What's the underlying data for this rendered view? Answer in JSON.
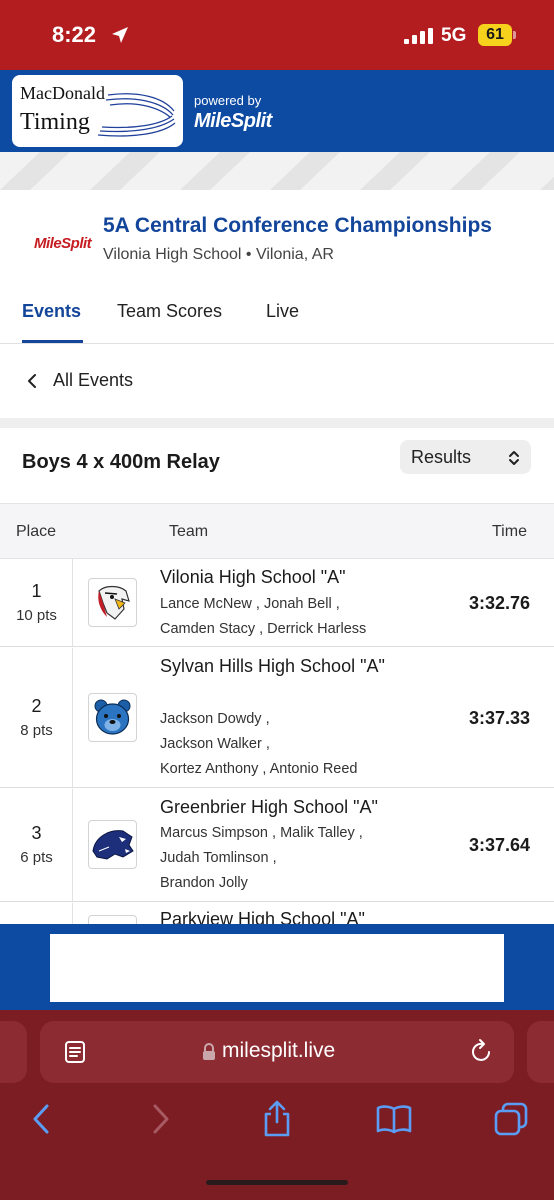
{
  "status_bar": {
    "time": "8:22",
    "network": "5G",
    "battery": "61"
  },
  "brand": {
    "logo_line1": "MacDonald",
    "logo_line2": "Timing",
    "powered_by": "powered by",
    "powered_brand": "MileSplit"
  },
  "meet": {
    "logo_text": "MileSplit",
    "title": "5A Central Conference Championships",
    "subtitle": "Vilonia High School • Vilonia, AR"
  },
  "tabs": [
    {
      "label": "Events",
      "active": true
    },
    {
      "label": "Team Scores",
      "active": false
    },
    {
      "label": "Live",
      "active": false
    }
  ],
  "back_link": {
    "label": "All Events"
  },
  "event": {
    "title": "Boys 4 x 400m Relay",
    "view_select": {
      "value": "Results"
    }
  },
  "table": {
    "headers": {
      "place": "Place",
      "team": "Team",
      "time": "Time"
    },
    "rows": [
      {
        "place": "1",
        "points": "10 pts",
        "team": "Vilonia High School \"A\"",
        "athletes_line1": "Lance McNew ,  Jonah Bell ,",
        "athletes_line2": "Camden Stacy ,  Derrick Harless",
        "athletes_line3": "",
        "time": "3:32.76",
        "logo": "eagle-mascot"
      },
      {
        "place": "2",
        "points": "8 pts",
        "team": "Sylvan Hills High School \"A\"",
        "athletes_line1": "Jackson Dowdy ,",
        "athletes_line2": "Jackson Walker ,",
        "athletes_line3": "Kortez Anthony ,  Antonio Reed",
        "time": "3:37.33",
        "logo": "bear-mascot"
      },
      {
        "place": "3",
        "points": "6 pts",
        "team": "Greenbrier High School \"A\"",
        "athletes_line1": "Marcus Simpson ,  Malik Talley ,",
        "athletes_line2": "Judah Tomlinson ,",
        "athletes_line3": "Brandon Jolly",
        "time": "3:37.64",
        "logo": "panther-mascot"
      },
      {
        "place": "",
        "points": "",
        "team": "Parkview High School \"A\"",
        "athletes_line1": "",
        "athletes_line2": "",
        "athletes_line3": "",
        "time": "",
        "logo": ""
      }
    ]
  },
  "browser": {
    "url": "milesplit.live"
  },
  "colors": {
    "status_red": "#b31d20",
    "brand_blue": "#0d4aa2",
    "title_blue": "#13469a",
    "chrome_red": "#7c1d24"
  }
}
